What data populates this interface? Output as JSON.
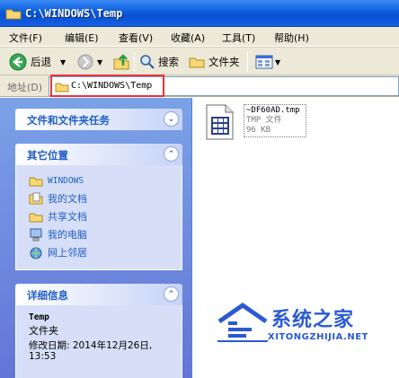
{
  "window": {
    "title": "C:\\WINDOWS\\Temp"
  },
  "menu": [
    "文件(F)",
    "编辑(E)",
    "查看(V)",
    "收藏(A)",
    "工具(T)",
    "帮助(H)"
  ],
  "toolbar": {
    "back_label": "后退",
    "search_label": "搜索",
    "folders_label": "文件夹"
  },
  "address": {
    "label": "地址(D)",
    "value": "C:\\WINDOWS\\Temp"
  },
  "tasks": {
    "file_tasks_title": "文件和文件夹任务",
    "other_places_title": "其它位置",
    "other_places": [
      {
        "label": "WINDOWS",
        "icon": "folder-icon"
      },
      {
        "label": "我的文档",
        "icon": "my-documents-icon"
      },
      {
        "label": "共享文档",
        "icon": "folder-icon"
      },
      {
        "label": "我的电脑",
        "icon": "my-computer-icon"
      },
      {
        "label": "网上邻居",
        "icon": "network-places-icon"
      }
    ],
    "details_title": "详细信息",
    "details": {
      "name": "Temp",
      "type": "文件夹",
      "modified": "修改日期: 2014年12月26日,",
      "modified_time": "13:53"
    }
  },
  "files": [
    {
      "name": "~DF60AD.tmp",
      "type": "TMP 文件",
      "size": "96 KB"
    }
  ],
  "watermark": {
    "cn": "系统之家",
    "en": "XITONGZHIJIA.NET"
  },
  "colors": {
    "titlebar": "#0a5ddf",
    "taskpane": "#6375d6",
    "highlight_box": "#e8333a",
    "link": "#215dc6"
  }
}
